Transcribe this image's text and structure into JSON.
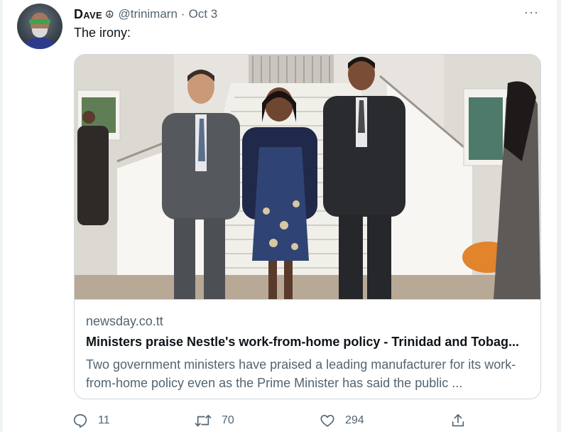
{
  "tweet": {
    "author": {
      "display_name": "Dave",
      "emoji": "☮",
      "handle": "@trinimarn",
      "separator": "·",
      "date": "Oct 3"
    },
    "text": "The irony:",
    "more_menu": "···"
  },
  "card": {
    "domain": "newsday.co.tt",
    "title": "Ministers praise Nestle's work-from-home policy - Trinidad and Tobag...",
    "description": "Two government ministers have praised a leading manufacturer for its work-from-home policy even as the Prime Minister has said the public ..."
  },
  "actions": {
    "reply_count": "11",
    "retweet_count": "70",
    "like_count": "294"
  },
  "icons": {
    "reply": "speech-bubble-icon",
    "retweet": "retweet-arrows-icon",
    "like": "heart-icon",
    "share": "share-upload-icon",
    "more": "ellipsis-icon",
    "emoji": "peace-symbol-icon"
  },
  "colors": {
    "secondary_text": "#536471",
    "border": "#cfd9de",
    "primary_text": "#0f1419"
  }
}
